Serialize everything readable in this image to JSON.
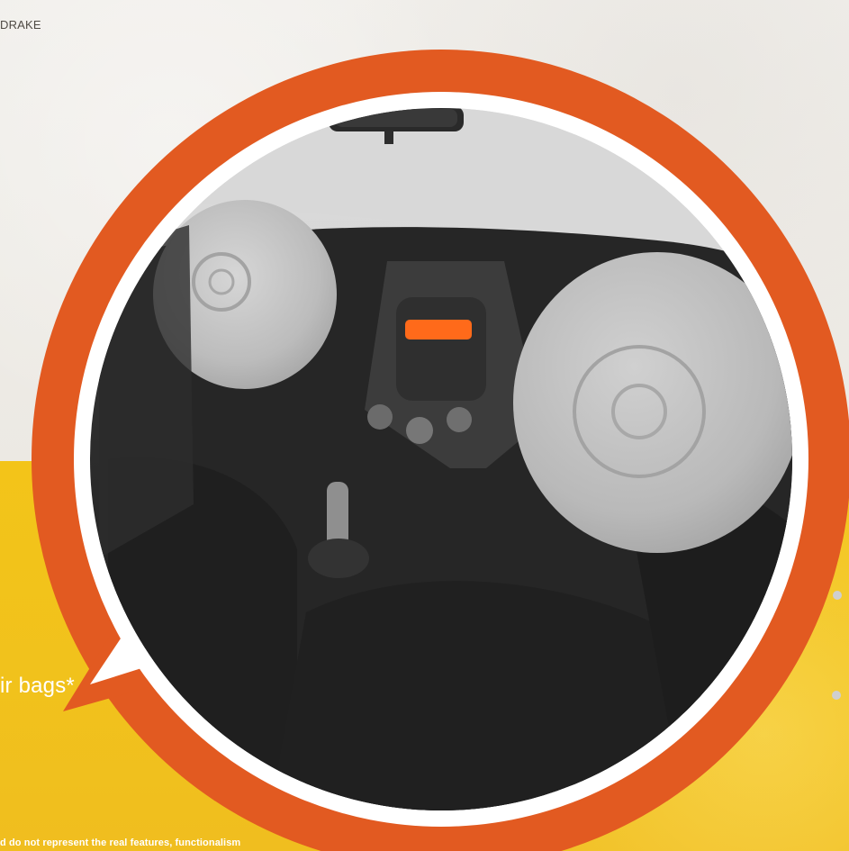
{
  "header": {
    "label": "DRAKE"
  },
  "feature": {
    "label": "ir bags*"
  },
  "footer": {
    "note": "d do not represent the real features, functionalism"
  },
  "colors": {
    "orange": "#e25a21",
    "yellow": "#f2c21c",
    "white": "#ffffff",
    "interior_dark": "#222222",
    "airbag": "#b9b9b9",
    "sky": "#d9d9d9"
  },
  "visual": {
    "subject": "car-interior-airbags",
    "type": "promotional-callout"
  },
  "bullets": [
    {
      "state": "inactive"
    },
    {
      "state": "inactive"
    }
  ]
}
